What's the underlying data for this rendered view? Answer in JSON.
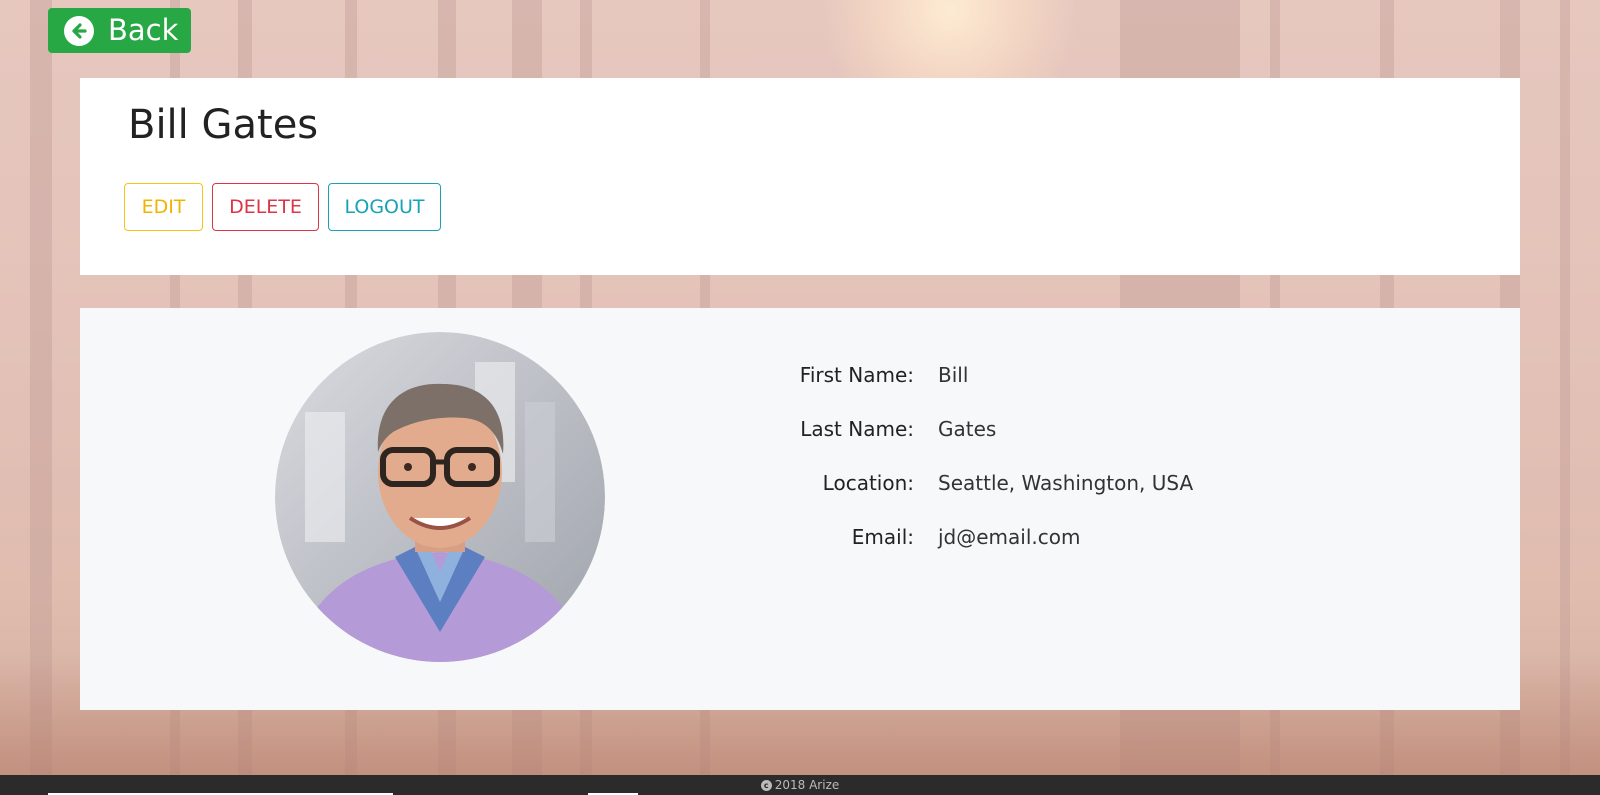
{
  "nav": {
    "back_label": "Back"
  },
  "profile": {
    "name": "Bill Gates",
    "actions": {
      "edit": "EDIT",
      "delete": "DELETE",
      "logout": "LOGOUT"
    },
    "fields": [
      {
        "label": "First Name:",
        "value": "Bill"
      },
      {
        "label": "Last Name:",
        "value": "Gates"
      },
      {
        "label": "Location:",
        "value": "Seattle, Washington, USA"
      },
      {
        "label": "Email:",
        "value": "jd@email.com"
      }
    ]
  },
  "footer": {
    "text": "2018 Arize"
  },
  "colors": {
    "back_button": "#28a745",
    "edit": "#f0b400",
    "delete": "#dc3545",
    "logout": "#17a2b8",
    "footer_bg": "#2b2b2b"
  },
  "icons": {
    "back": "arrow-circle-left-icon",
    "copyright": "copyright-icon"
  }
}
